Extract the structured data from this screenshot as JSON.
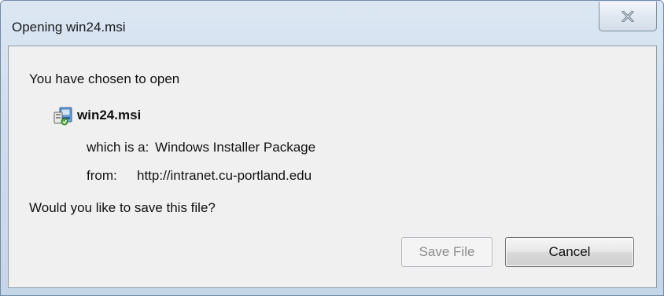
{
  "window": {
    "title": "Opening win24.msi"
  },
  "dialog": {
    "chosen_text": "You have chosen to open",
    "file_name": "win24.msi",
    "file_icon": "msi-installer-icon",
    "which_is_label": "which is a:",
    "which_is_value": "Windows Installer Package",
    "from_label": "from:",
    "from_value": "http://intranet.cu-portland.edu",
    "question": "Would you like to save this file?"
  },
  "buttons": {
    "save_label": "Save File",
    "save_enabled": false,
    "cancel_label": "Cancel"
  },
  "colors": {
    "title_gradient_top": "#dce7f3",
    "content_bg": "#f0f0f0",
    "disabled_text": "#8c8c8c"
  }
}
